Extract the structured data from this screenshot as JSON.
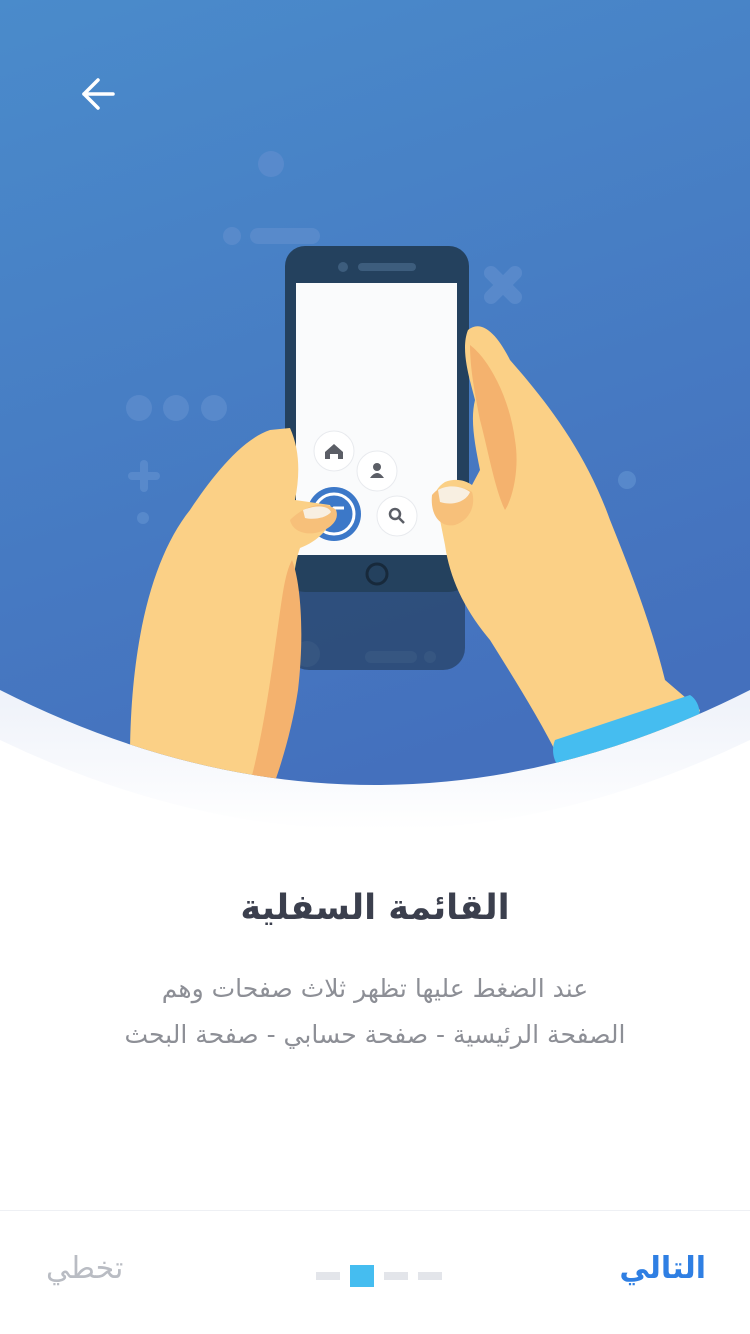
{
  "header": {
    "back_icon": "arrow-left-icon"
  },
  "illustration": {
    "phone_menu_icons": [
      "home-icon",
      "user-icon",
      "search-icon",
      "app-logo-icon"
    ]
  },
  "content": {
    "title": "القائمة السفلية",
    "description_line1": "عند الضغط عليها تظهر ثلاث صفحات وهم",
    "description_line2": "الصفحة الرئيسية - صفحة حسابي - صفحة البحث"
  },
  "footer": {
    "skip_label": "تخطي",
    "next_label": "التالي",
    "pagination": {
      "total": 4,
      "current": 2
    }
  },
  "colors": {
    "hero_blue": "#4477c4",
    "accent": "#2f7fe3",
    "active_dot": "#45bdf0",
    "title_text": "#3b3f4d",
    "body_text": "#8d8f96"
  }
}
